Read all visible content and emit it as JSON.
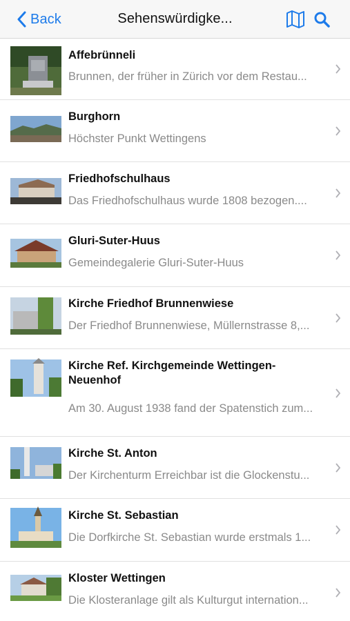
{
  "nav": {
    "back_label": "Back",
    "title": "Sehenswürdigke...",
    "accent_color": "#1d7bea",
    "icons": [
      "map-icon",
      "search-icon"
    ]
  },
  "items": [
    {
      "title": "Affebrünneli",
      "subtitle": "Brunnen, der früher in Zürich vor dem Restau..."
    },
    {
      "title": "Burghorn",
      "subtitle": "Höchster Punkt Wettingens"
    },
    {
      "title": "Friedhofschulhaus",
      "subtitle": "Das Friedhofschulhaus wurde 1808 bezogen...."
    },
    {
      "title": "Gluri-Suter-Huus",
      "subtitle": "Gemeindegalerie Gluri-Suter-Huus"
    },
    {
      "title": "Kirche Friedhof Brunnenwiese",
      "subtitle": "Der Friedhof Brunnenwiese, Müllernstrasse 8,..."
    },
    {
      "title": "Kirche Ref. Kirchgemeinde Wettingen-Neuenhof",
      "subtitle": "Am 30. August 1938 fand der Spatenstich zum..."
    },
    {
      "title": "Kirche St. Anton",
      "subtitle": "Der Kirchenturm  Erreichbar ist die Glockenstu..."
    },
    {
      "title": "Kirche St. Sebastian",
      "subtitle": "Die Dorfkirche St. Sebastian wurde erstmals 1..."
    },
    {
      "title": "Kloster Wettingen",
      "subtitle": "Die Klosteranlage gilt als Kulturgut internation..."
    }
  ]
}
